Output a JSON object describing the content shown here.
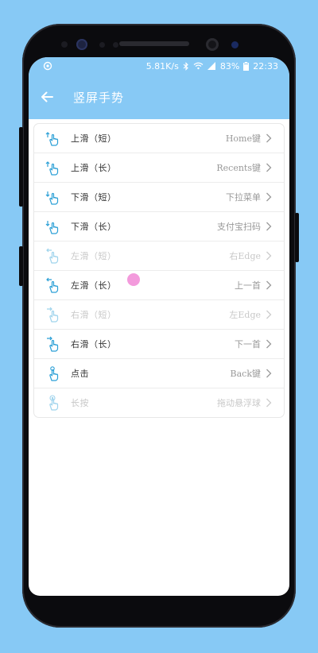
{
  "status_bar": {
    "speed": "5.81K/s",
    "battery": "83%",
    "time": "22:33"
  },
  "app_bar": {
    "title": "竖屏手势"
  },
  "gestures": [
    {
      "label": "上滑（短）",
      "value": "Home键",
      "enabled": true,
      "icon": "swipe-up-short-icon"
    },
    {
      "label": "上滑（长）",
      "value": "Recents键",
      "enabled": true,
      "icon": "swipe-up-long-icon"
    },
    {
      "label": "下滑（短）",
      "value": "下拉菜单",
      "enabled": true,
      "icon": "swipe-down-short-icon"
    },
    {
      "label": "下滑（长）",
      "value": "支付宝扫码",
      "enabled": true,
      "icon": "swipe-down-long-icon"
    },
    {
      "label": "左滑（短）",
      "value": "右Edge",
      "enabled": false,
      "icon": "swipe-left-short-icon"
    },
    {
      "label": "左滑（长）",
      "value": "上一首",
      "enabled": true,
      "icon": "swipe-left-long-icon"
    },
    {
      "label": "右滑（短）",
      "value": "左Edge",
      "enabled": false,
      "icon": "swipe-right-short-icon"
    },
    {
      "label": "右滑（长）",
      "value": "下一首",
      "enabled": true,
      "icon": "swipe-right-long-icon"
    },
    {
      "label": "点击",
      "value": "Back键",
      "enabled": true,
      "icon": "tap-icon"
    },
    {
      "label": "长按",
      "value": "拖动悬浮球",
      "enabled": false,
      "icon": "long-press-icon"
    }
  ],
  "colors": {
    "accent": "#87c9f5",
    "icon": "#2a9fd6",
    "touch_indicator": "#f28fd8"
  }
}
